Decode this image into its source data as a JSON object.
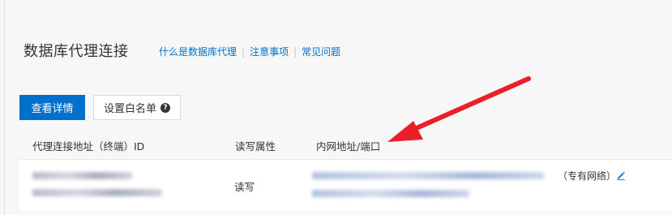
{
  "header": {
    "title": "数据库代理连接",
    "links": [
      "什么是数据库代理",
      "注意事项",
      "常见问题"
    ]
  },
  "toolbar": {
    "view_details_label": "查看详情",
    "whitelist_label": "设置白名单",
    "help_icon": "?"
  },
  "table": {
    "columns": {
      "address_id": "代理连接地址（终端）ID",
      "rw_attr": "读写属性",
      "intranet": "内网地址/端口"
    },
    "rows": [
      {
        "rw_attr": "读写",
        "network_type": "（专有网络）"
      }
    ]
  },
  "annotation": {
    "arrow_color": "#e8202a"
  },
  "colors": {
    "accent": "#0070cc",
    "link": "#0070cc"
  }
}
